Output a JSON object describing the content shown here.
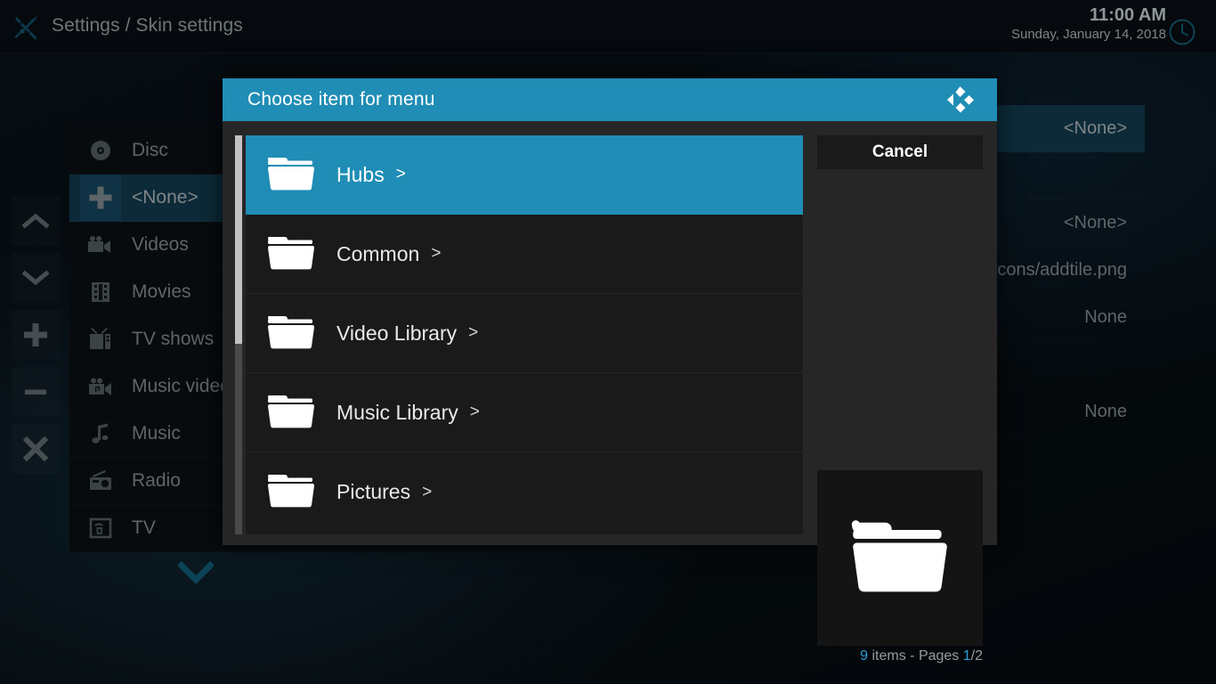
{
  "topbar": {
    "icon": "brush-icon",
    "title": "Settings / Skin settings",
    "clock_time": "11:00 AM",
    "clock_date": "Sunday, January 14, 2018",
    "clock_icon": "clock-icon"
  },
  "side_buttons": [
    {
      "name": "scroll-up-button",
      "icon": "chevron-up-icon"
    },
    {
      "name": "scroll-down-button",
      "icon": "chevron-down-icon"
    },
    {
      "name": "add-button",
      "icon": "plus-icon"
    },
    {
      "name": "remove-button",
      "icon": "minus-icon"
    },
    {
      "name": "delete-button",
      "icon": "close-icon"
    }
  ],
  "background_list": {
    "items": [
      {
        "label": "Disc",
        "icon": "disc-icon",
        "selected": false
      },
      {
        "label": "<None>",
        "icon": "plus-icon",
        "selected": true
      },
      {
        "label": "Videos",
        "icon": "video-camera-icon",
        "selected": false
      },
      {
        "label": "Movies",
        "icon": "film-strip-icon",
        "selected": false
      },
      {
        "label": "TV shows",
        "icon": "television-icon",
        "selected": false
      },
      {
        "label": "Music videos",
        "icon": "music-video-icon",
        "selected": false
      },
      {
        "label": "Music",
        "icon": "music-note-icon",
        "selected": false
      },
      {
        "label": "Radio",
        "icon": "radio-icon",
        "selected": false
      },
      {
        "label": "TV",
        "icon": "tv-box-icon",
        "selected": false
      }
    ],
    "scroll_down_icon": "chevron-down-icon"
  },
  "background_values": [
    {
      "value": "<None>",
      "selected": true
    },
    {
      "value": "",
      "selected": false
    },
    {
      "value": "<None>",
      "selected": false
    },
    {
      "value": "cons/addtile.png",
      "selected": false
    },
    {
      "value": "None",
      "selected": false
    },
    {
      "value": "",
      "selected": false
    },
    {
      "value": "None",
      "selected": false
    },
    {
      "value": "",
      "selected": false
    }
  ],
  "dialog": {
    "title": "Choose item for menu",
    "logo_icon": "kodi-logo-icon",
    "items": [
      {
        "label": "Hubs",
        "arrow": ">",
        "icon": "folder-icon",
        "selected": true
      },
      {
        "label": "Common",
        "arrow": ">",
        "icon": "folder-icon",
        "selected": false
      },
      {
        "label": "Video Library",
        "arrow": ">",
        "icon": "folder-icon",
        "selected": false
      },
      {
        "label": "Music Library",
        "arrow": ">",
        "icon": "folder-icon",
        "selected": false
      },
      {
        "label": "Pictures",
        "arrow": ">",
        "icon": "folder-icon",
        "selected": false
      }
    ],
    "cancel_label": "Cancel",
    "preview_icon": "folder-icon",
    "pagination": {
      "item_count": "9",
      "items_word": " items - Pages ",
      "current_page": "1",
      "page_separator": "/2"
    }
  },
  "colors": {
    "accent_blue": "#1f8db5",
    "link_blue": "#2b9fd4",
    "dialog_bg": "#262626",
    "list_bg": "#1a1a1a",
    "selected_row_bg": "#0c2a38"
  }
}
